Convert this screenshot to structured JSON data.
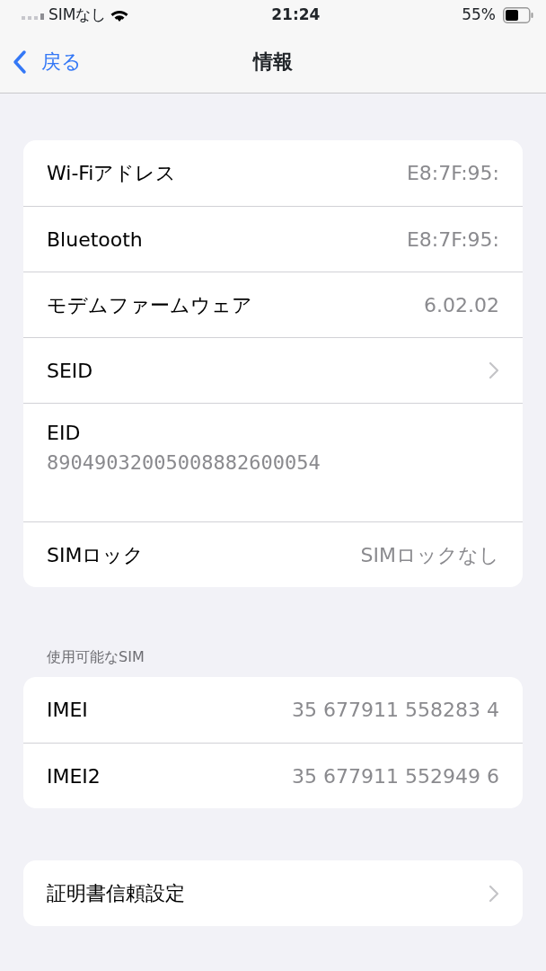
{
  "status_bar": {
    "carrier": "SIMなし",
    "time": "21:24",
    "battery": "55%"
  },
  "nav": {
    "back": "戻る",
    "title": "情報"
  },
  "groups": [
    {
      "rows": [
        {
          "kind": "value",
          "label": "Wi-Fiアドレス",
          "value": "E8:7F:95:"
        },
        {
          "kind": "value",
          "label": "Bluetooth",
          "value": "E8:7F:95:"
        },
        {
          "kind": "value",
          "label": "モデムファームウェア",
          "value": "6.02.02"
        },
        {
          "kind": "chevron",
          "label": "SEID"
        },
        {
          "kind": "stacked",
          "label": "EID",
          "value": "89049032005008882600054"
        },
        {
          "kind": "value",
          "label": "SIMロック",
          "value": "SIMロックなし"
        }
      ]
    },
    {
      "header": "使用可能なSIM",
      "rows": [
        {
          "kind": "value",
          "label": "IMEI",
          "value": "35 677911 558283 4"
        },
        {
          "kind": "value",
          "label": "IMEI2",
          "value": "35 677911 552949 6"
        }
      ]
    },
    {
      "rows": [
        {
          "kind": "chevron",
          "label": "証明書信頼設定"
        }
      ]
    }
  ]
}
